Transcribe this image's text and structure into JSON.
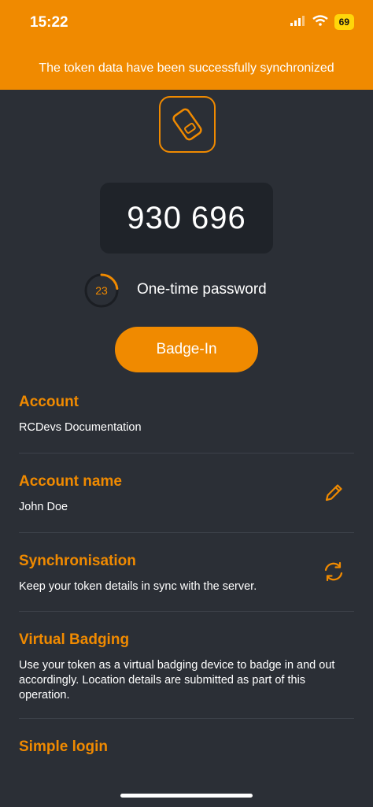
{
  "status": {
    "time": "15:22",
    "battery": "69"
  },
  "banner": {
    "message": "The token data have been successfully synchronized"
  },
  "otp": {
    "code": "930 696",
    "seconds_left": "23",
    "label": "One-time password",
    "progress": 0.23
  },
  "badge": {
    "label": "Badge-In"
  },
  "sections": [
    {
      "title": "Account",
      "text": "RCDevs Documentation"
    },
    {
      "title": "Account name",
      "text": "John Doe"
    },
    {
      "title": "Synchronisation",
      "text": "Keep your token details in sync with the server."
    },
    {
      "title": "Virtual Badging",
      "text": "Use your token as a virtual badging device to badge in and out accordingly. Location details are submitted as part of this operation."
    },
    {
      "title": "Simple login",
      "text": ""
    }
  ],
  "colors": {
    "accent": "#f08a00",
    "background": "#2b2f36",
    "otp_box": "#1f2329"
  },
  "icons": [
    "token-badge-icon",
    "edit-pencil-icon",
    "sync-icon",
    "signal-icon",
    "wifi-icon",
    "battery-icon"
  ]
}
